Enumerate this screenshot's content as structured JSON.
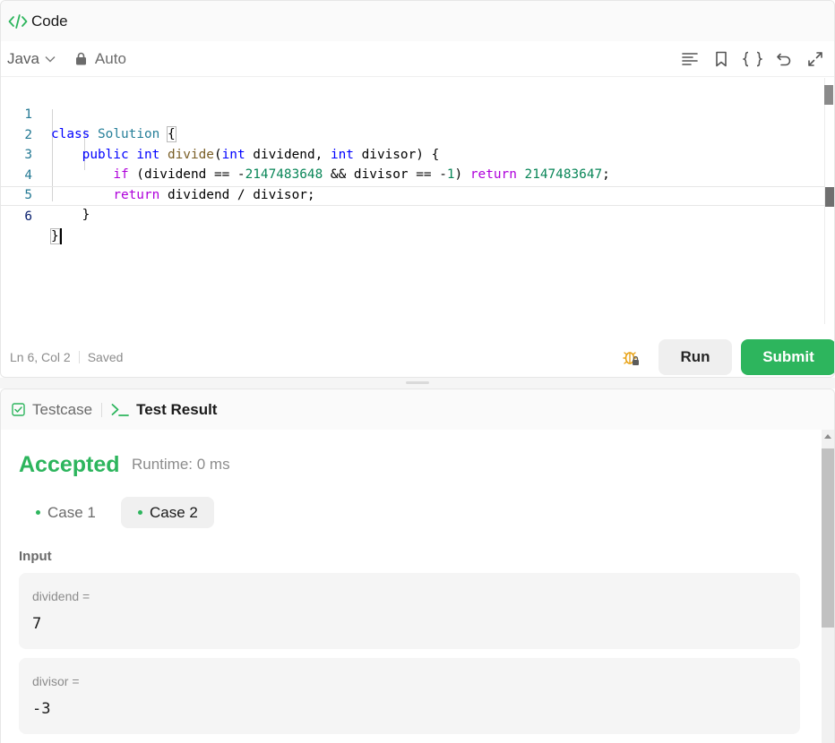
{
  "code_panel": {
    "title": "Code",
    "language": "Java",
    "mode": "Auto",
    "toolbar_icons": [
      "format-icon",
      "bookmark-icon",
      "braces-icon",
      "reset-icon",
      "expand-icon"
    ]
  },
  "editor": {
    "line_numbers": [
      "1",
      "2",
      "3",
      "4",
      "5",
      "6"
    ],
    "lines": [
      "class Solution {",
      "    public int divide(int dividend, int divisor) {",
      "        if (dividend == -2147483648 && divisor == -1) return 2147483647;",
      "        return dividend / divisor;",
      "    }",
      "}"
    ]
  },
  "status": {
    "position": "Ln 6, Col 2",
    "save_state": "Saved"
  },
  "actions": {
    "run_label": "Run",
    "submit_label": "Submit"
  },
  "result_panel": {
    "tabs": [
      "Testcase",
      "Test Result"
    ],
    "verdict": "Accepted",
    "runtime": "Runtime: 0 ms",
    "cases": [
      "Case 1",
      "Case 2"
    ],
    "selected_case": "Case 2",
    "input_label": "Input",
    "params": [
      {
        "name": "dividend =",
        "value": "7"
      },
      {
        "name": "divisor =",
        "value": "-3"
      }
    ]
  },
  "colors": {
    "accent_green": "#2db55d",
    "keyword_blue": "#0000ff",
    "control_purple": "#af00db",
    "class_teal": "#267f99",
    "number_green": "#098658"
  }
}
